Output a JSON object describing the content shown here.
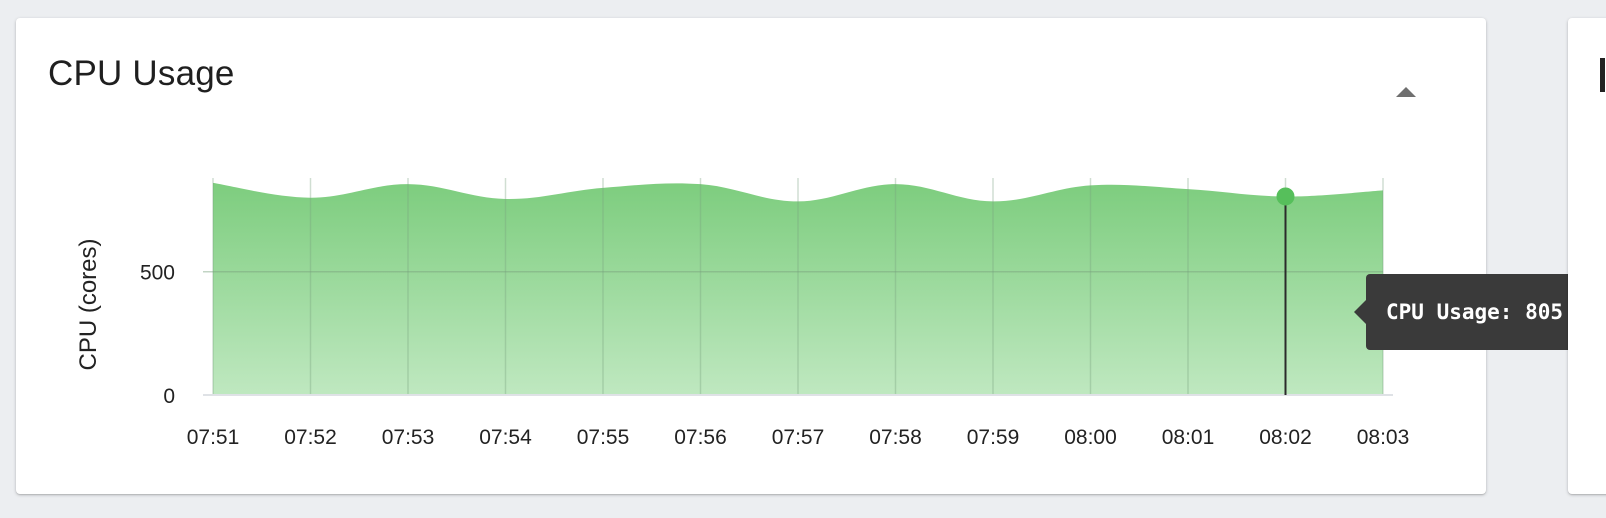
{
  "card": {
    "title": "CPU Usage",
    "collapse_icon": "chevron-up-icon"
  },
  "colors": {
    "fill_top": "#7dcd7e",
    "fill_bottom": "#bfe8c0",
    "point": "#56bf5b",
    "tooltip_bg": "#3a3a3a",
    "grid": "#dfe2e6"
  },
  "tooltip": {
    "text": "CPU Usage: 805"
  },
  "chart_data": {
    "type": "area",
    "ylabel": "CPU (cores)",
    "xlabel": "",
    "ylim": [
      0,
      880
    ],
    "yticks": [
      0,
      500
    ],
    "x": [
      "07:51",
      "07:52",
      "07:53",
      "07:54",
      "07:55",
      "07:56",
      "07:57",
      "07:58",
      "07:59",
      "08:00",
      "08:01",
      "08:02",
      "08:03"
    ],
    "series": [
      {
        "values": [
          860,
          800,
          855,
          795,
          840,
          855,
          785,
          855,
          785,
          850,
          835,
          805,
          830
        ]
      }
    ],
    "grid": true,
    "highlight": {
      "index": 11,
      "value": 805
    }
  }
}
